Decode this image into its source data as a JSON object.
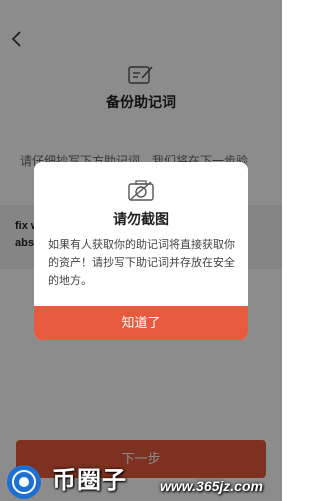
{
  "background": {
    "title": "备份助记词",
    "instructions": "请仔细抄写下方助记词，我们将在下一步验",
    "phrase_preview": "fix w…\nabs…",
    "bottom_button_label": "下一步"
  },
  "dialog": {
    "title": "请勿截图",
    "message": "如果有人获取你的助记词将直接获取你的资产！请抄写下助记词并存放在安全的地方。",
    "confirm_label": "知道了"
  },
  "watermark": {
    "brand": "币圈子",
    "url": "www.365jz.com"
  },
  "colors": {
    "accent": "#e75a3d",
    "overlay": "rgba(0,0,0,0.45)"
  },
  "icons": {
    "back": "chevron-left-icon",
    "backup": "edit-card-icon",
    "dialog": "no-camera-icon",
    "watermark_logo": "coin-logo-icon"
  }
}
